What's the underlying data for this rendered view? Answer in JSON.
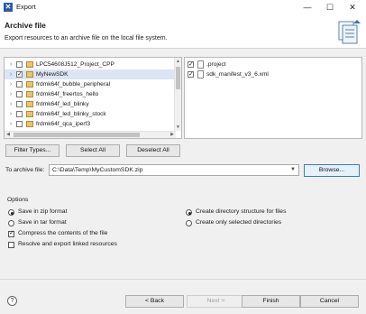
{
  "window": {
    "title": "Export",
    "app_icon": "eclipse-x-icon"
  },
  "header": {
    "title": "Archive file",
    "description": "Export resources to an archive file on the local file system."
  },
  "tree": {
    "items": [
      {
        "label": "LPC54608J512_Project_CPP",
        "checked": false,
        "selected": false
      },
      {
        "label": "MyNewSDK",
        "checked": true,
        "selected": true
      },
      {
        "label": "frdmk64f_bubble_peripheral",
        "checked": false,
        "selected": false
      },
      {
        "label": "frdmk64f_freertos_hello",
        "checked": false,
        "selected": false
      },
      {
        "label": "frdmk64f_led_blinky",
        "checked": false,
        "selected": false
      },
      {
        "label": "frdmk64f_led_blinky_stock",
        "checked": false,
        "selected": false
      },
      {
        "label": "frdmk64f_qca_iperf3",
        "checked": false,
        "selected": false
      }
    ]
  },
  "files": {
    "items": [
      {
        "label": ".project",
        "checked": true
      },
      {
        "label": "sdk_manifest_v3_6.xml",
        "checked": true
      }
    ]
  },
  "selection_buttons": {
    "filter": "Filter Types...",
    "select_all": "Select All",
    "deselect_all": "Deselect All"
  },
  "archive": {
    "label": "To archive file:",
    "value": "C:\\Data\\Temp\\MyCustomSDK.zip",
    "browse": "Browse..."
  },
  "options": {
    "title": "Options",
    "zip": "Save in zip format",
    "tar": "Save in tar format",
    "compress": "Compress the contents of the file",
    "resolve": "Resolve and export linked resources",
    "dir_structure": "Create directory structure for files",
    "selected_dirs": "Create only selected directories"
  },
  "footer": {
    "back": "< Back",
    "next": "Next >",
    "finish": "Finish",
    "cancel": "Cancel"
  }
}
